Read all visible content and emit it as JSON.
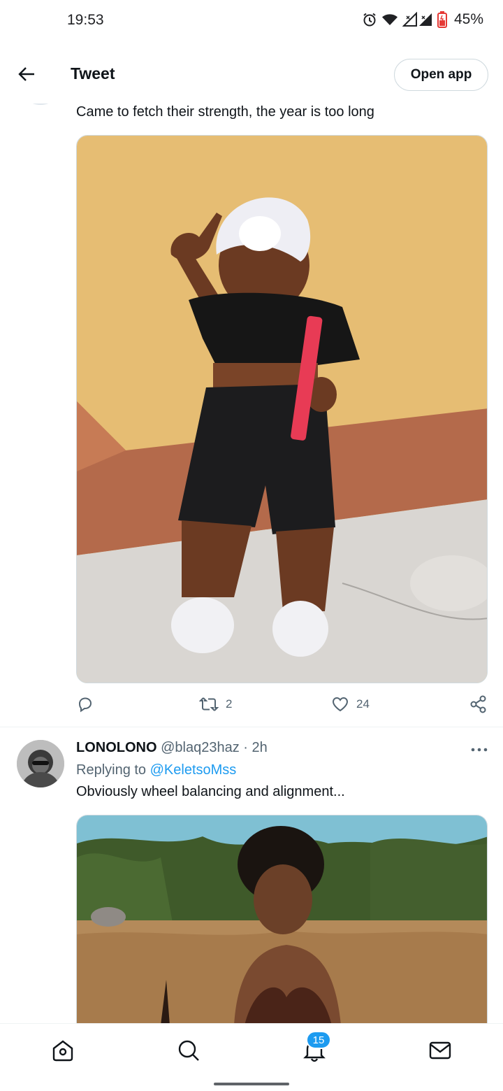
{
  "status": {
    "time": "19:53",
    "battery_text": "45%"
  },
  "header": {
    "title": "Tweet",
    "open_app_label": "Open app"
  },
  "tweet1": {
    "text": "Came to fetch their strength, the year is too long",
    "media_icon": "photo-child-dancing",
    "actions": {
      "reply_count": "",
      "retweet_count": "2",
      "like_count": "24"
    }
  },
  "tweet2": {
    "name": "LONOLONO",
    "handle": "@blaq23haz",
    "separator": "·",
    "time": "2h",
    "replying_prefix": "Replying to",
    "replying_to": "@KeletsoMss",
    "text": "Obviously wheel balancing and alignment...",
    "media_icon": "photo-woman-outdoors"
  },
  "bottom_nav": {
    "items": [
      "home-icon",
      "search-icon",
      "notifications-icon",
      "messages-icon"
    ],
    "notifications_badge": "15"
  },
  "colors": {
    "accent": "#1d9bf0",
    "text_primary": "#0f1419",
    "text_secondary": "#536471",
    "border": "#cfd9de"
  }
}
